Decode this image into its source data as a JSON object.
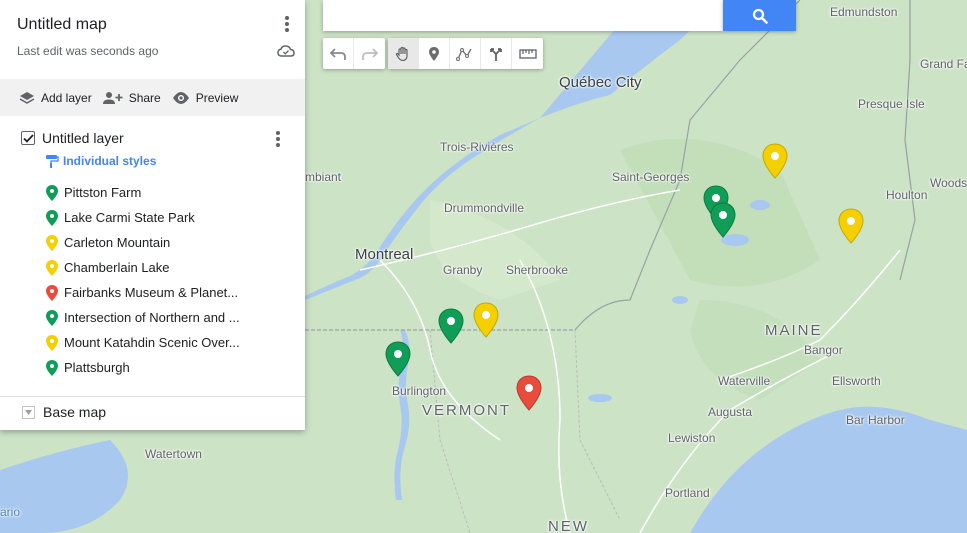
{
  "map_title": "Untitled map",
  "last_edit": "Last edit was seconds ago",
  "actions": {
    "add_layer": "Add layer",
    "share": "Share",
    "preview": "Preview"
  },
  "layer": {
    "name": "Untitled layer",
    "styles": "Individual styles",
    "places": [
      {
        "name": "Pittston Farm",
        "color": "#0f9d58"
      },
      {
        "name": "Lake Carmi State Park",
        "color": "#0f9d58"
      },
      {
        "name": "Carleton Mountain",
        "color": "#f4d000"
      },
      {
        "name": "Chamberlain Lake",
        "color": "#f4d000"
      },
      {
        "name": "Fairbanks Museum & Planet...",
        "color": "#e84c3d"
      },
      {
        "name": "Intersection of Northern and ...",
        "color": "#0f9d58"
      },
      {
        "name": "Mount Katahdin Scenic Over...",
        "color": "#f4d000"
      },
      {
        "name": "Plattsburgh",
        "color": "#0f9d58"
      }
    ]
  },
  "base_map": "Base map",
  "labels": {
    "edmundston": "Edmundston",
    "grand_falls": "Grand Fa",
    "presque_isle": "Presque Isle",
    "quebec_city": "Québec City",
    "trois_rivieres": "Trois-Rivières",
    "saint_georges": "Saint-Georges",
    "woodstock": "Woods",
    "houlton": "Houlton",
    "bellechasse": "mbiant",
    "drummondville": "Drummondville",
    "montreal": "Montreal",
    "granby": "Granby",
    "sherbrooke": "Sherbrooke",
    "maine": "MAINE",
    "bangor": "Bangor",
    "waterville": "Waterville",
    "ellsworth": "Ellsworth",
    "burlington": "Burlington",
    "vermont": "VERMONT",
    "augusta": "Augusta",
    "bar_harbor": "Bar Harbor",
    "lewiston": "Lewiston",
    "watertown": "Watertown",
    "portland": "Portland",
    "new": "NEW",
    "ontario": "ario"
  },
  "colors": {
    "green": "#0f9d58",
    "yellow": "#f4d000",
    "red": "#e84c3d",
    "accent": "#4285f4"
  }
}
